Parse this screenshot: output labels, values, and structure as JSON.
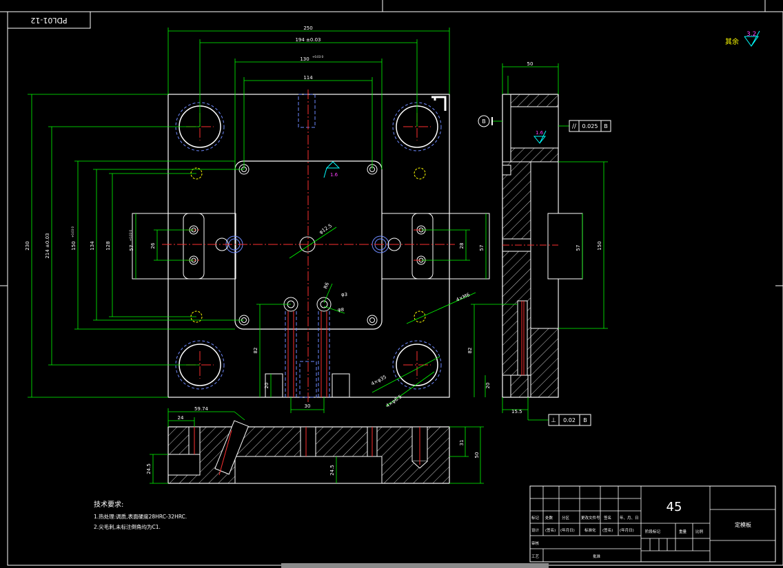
{
  "drawing": {
    "code": "PDL01-12",
    "material": "45",
    "part_name": "定模板",
    "roughness_other_label": "其余",
    "roughness_other_value": "3.2"
  },
  "plan_dims": {
    "w250": "250",
    "w194": "194 ±0.03",
    "w130": "130",
    "w130_tol": "+0.03 0",
    "w114": "114",
    "h230": "230",
    "h214": "214 ±0.03",
    "h150": "150",
    "h150_tol": "+0.03 0",
    "h134": "134",
    "h128": "128",
    "h57": "57",
    "h57_tol": "+0.03 0",
    "h26": "26",
    "h28": "28",
    "h57r": "57",
    "d82": "82",
    "d20": "20",
    "w30": "30",
    "phi12": "φ12.5",
    "thread": "4×M6",
    "holes35": "4×φ35",
    "holes_b": "4×φ6.5",
    "r6": "R6",
    "phi3": "φ3",
    "phi8": "φ8",
    "rough_center": "1.6"
  },
  "side_dims": {
    "w50": "50",
    "h150": "150",
    "h57": "57",
    "d82": "82",
    "d20": "20",
    "w15": "15.5",
    "rough": "1.6",
    "datum": "B",
    "parallel_tol": "0.025",
    "parallel_datum": "B",
    "perp_tol": "0.02",
    "perp_datum": "B"
  },
  "section_dims": {
    "w5974": "59.74",
    "w24": "24",
    "h31": "31",
    "h50": "50",
    "h245a": "24.5",
    "h245b": "24.5"
  },
  "tech_req": {
    "title": "技术要求:",
    "line1": "1.热处理:调质,表面硬度28HRC-32HRC.",
    "line2": "2.尖毛刺,未标注倒角均为C1."
  },
  "title_block": {
    "r3": [
      "标记",
      "处数",
      "分区",
      "更改文件号",
      "签名",
      "年、月、日"
    ],
    "r4": [
      "设计",
      "(签名)",
      "(年月日)",
      "标准化",
      "(签名)",
      "(年月日)"
    ],
    "r5": [
      "审核"
    ],
    "r6": [
      "工艺",
      "批准"
    ],
    "stage": [
      "阶段标记",
      "重量",
      "比例"
    ]
  }
}
